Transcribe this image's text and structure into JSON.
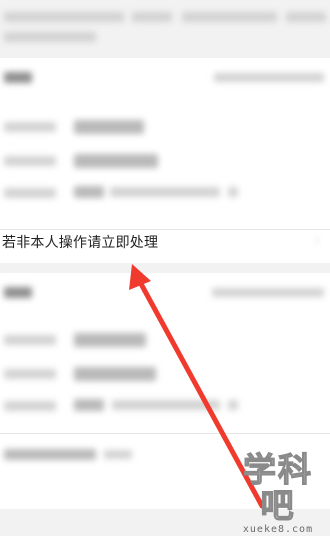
{
  "login_alert": {
    "action_text": "若非本人操作请立即处理",
    "chevron_icon": "chevron-right-icon"
  },
  "annotation": {
    "arrow_color": "#f03a2e"
  },
  "watermark": {
    "cn": "学科吧",
    "en": "xueke8.com"
  }
}
